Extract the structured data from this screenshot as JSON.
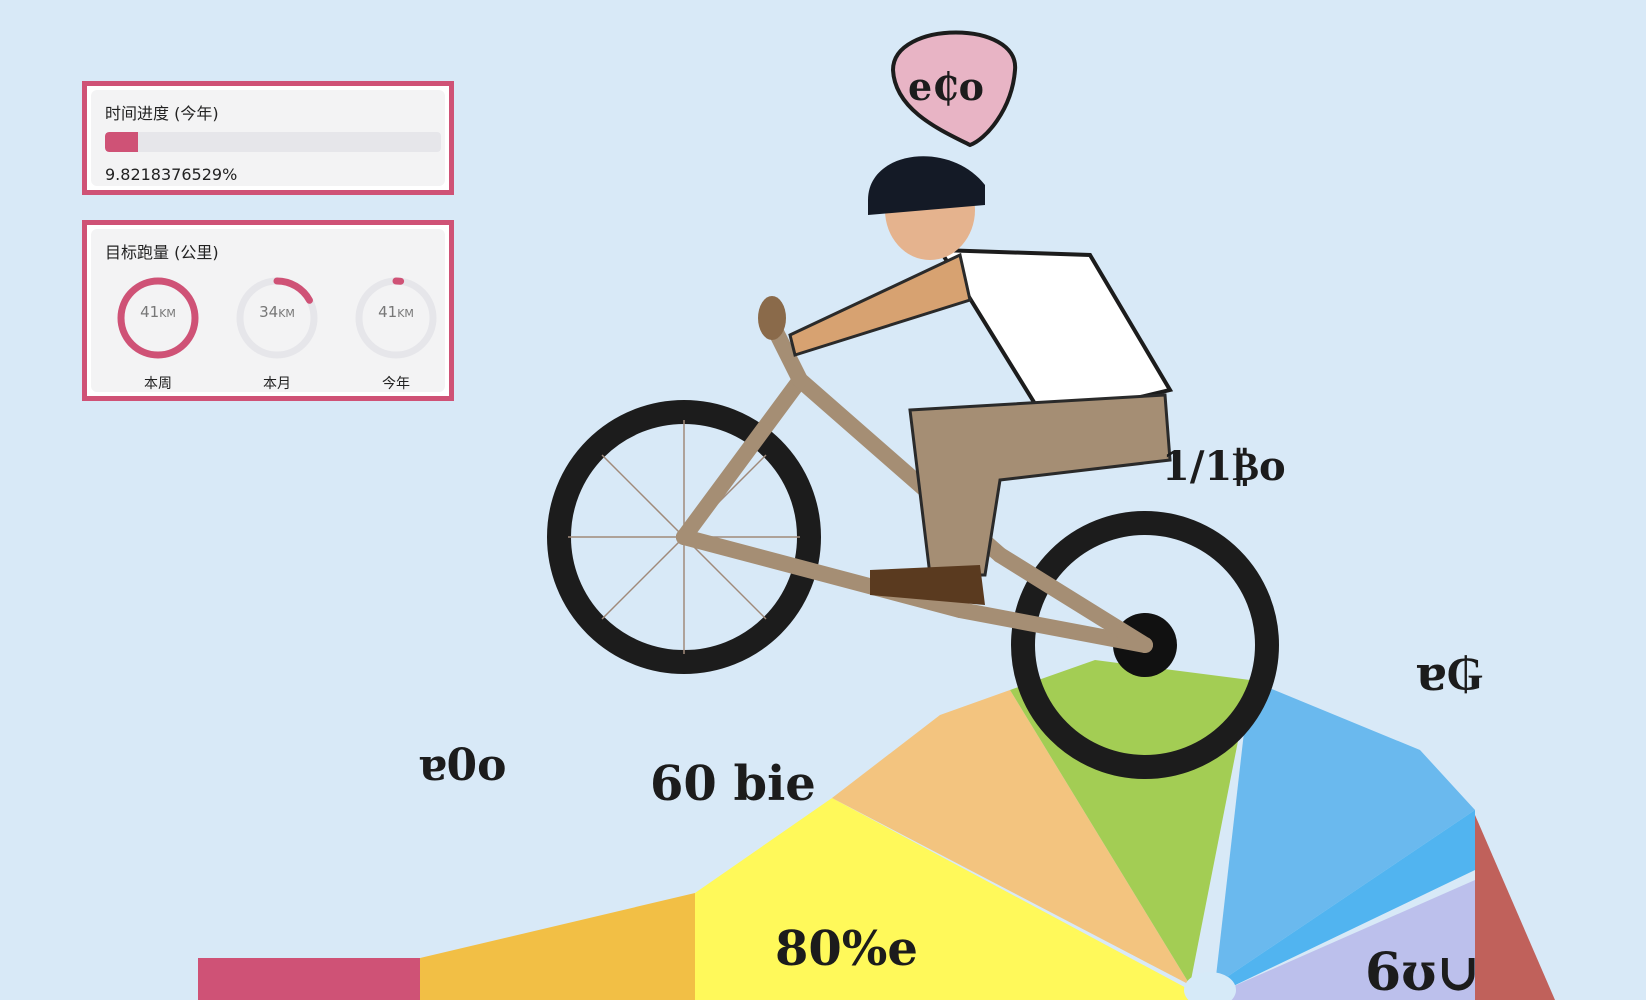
{
  "time_progress": {
    "title": "时间进度 (今年)",
    "percent": 9.8218376529,
    "percent_text": "9.8218376529%"
  },
  "goal": {
    "title": "目标跑量 (公里)",
    "rings": [
      {
        "label": "本周",
        "value": "41",
        "unit": "KM",
        "fraction": 1.0
      },
      {
        "label": "本月",
        "value": "34",
        "unit": "KM",
        "fraction": 0.17
      },
      {
        "label": "今年",
        "value": "41",
        "unit": "KM",
        "fraction": 0.02
      }
    ]
  },
  "illustration": {
    "badge_text": "e₵o",
    "labels": [
      "1/1₿o",
      "ɐ0o",
      "60 bie",
      "ɐ₲",
      "80%e",
      "6ʊ∪"
    ]
  },
  "colors": {
    "accent": "#cf5276",
    "background": "#d8e9f7",
    "track": "#e6e6ea"
  }
}
